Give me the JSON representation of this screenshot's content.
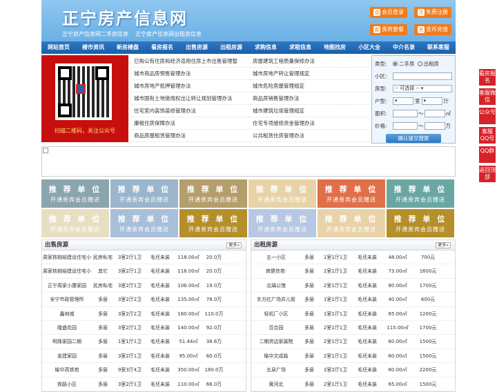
{
  "header": {
    "logo": "正宁房产信息网",
    "sub1": "正宁房产信息网二手房信息",
    "sub2": "正宁房产信息网出租房信息",
    "btns": [
      {
        "icon": "会",
        "label": "会员登录"
      },
      {
        "icon": "注",
        "label": "免费注册"
      },
      {
        "icon": "套",
        "label": "贵宾套餐"
      },
      {
        "icon": "充",
        "label": "金币充值"
      }
    ]
  },
  "nav": [
    "网站首页",
    "楼市资讯",
    "新房楼盘",
    "看房报名",
    "出售房源",
    "出租房源",
    "求购信息",
    "求租信息",
    "地图找房",
    "小区大全",
    "中介名录",
    "联系客服"
  ],
  "qr": {
    "caption": "扫描二维码，关注公众号"
  },
  "links": [
    "已购公有住房和经济适用住房上市出售管理暂",
    "房屋建筑工程质量保修办法",
    "城市商品房预售管理办法",
    "城市房地产转让管理规定",
    "城市房地产抵押管理办法",
    "城市危险房屋管理规定",
    "城市国有土地使用权出让转让规划管理办法",
    "商品房销售管理办法",
    "住宅室内装饰装修管理办法",
    "城市建筑垃圾管理规定",
    "廉租住房保障办法",
    "住宅专项维修资金管理办法",
    "商品房屋租赁管理办法",
    "公共租赁住房管理办法"
  ],
  "search": {
    "type_label": "类型:",
    "opt1": "二手房",
    "opt2": "出租房",
    "xiaoqu_label": "小区:",
    "fangxing_label": "房型:",
    "fangxing_value": "-- 可选择 --",
    "huxing_label": "户型:",
    "shi": "室",
    "ting": "厅",
    "area_label": "面积:",
    "area_unit": "㎡",
    "price_label": "价格:",
    "price_unit": "万",
    "submit": "确认提交搜索"
  },
  "ads": {
    "t1": "推 荐 单 位",
    "t2": "开通贵宾会员赠送",
    "colors": [
      "#8aa5ad",
      "#9bb5cc",
      "#b49e6b",
      "#e8d3a9",
      "#e0704a",
      "#6aa7a3",
      "#e8dfc3",
      "#a8bfd9",
      "#b48f2a",
      "#b6c8e2",
      "#e8d3a9",
      "#b48f2a"
    ]
  },
  "sale": {
    "title": "出售房源",
    "more": "更多»",
    "rows": [
      [
        "周家核桃峪建设住宅小",
        "民房私宅",
        "3室2厅1卫",
        "毛坯未装",
        "118.00㎡",
        "20.0万"
      ],
      [
        "周家核桃峪建设住宅小",
        "其它",
        "3室2厅1卫",
        "毛坯未装",
        "118.00㎡",
        "20.0万"
      ],
      [
        "正宁周家小康家园",
        "民房私宅",
        "3室2厅1卫",
        "毛坯未装",
        "106.00㎡",
        "19.0万"
      ],
      [
        "安宁市政管理所",
        "多层",
        "3室2厅2卫",
        "毛坯未装",
        "135.00㎡",
        "78.0万"
      ],
      [
        "鑫地城",
        "多层",
        "3室2厅2卫",
        "毛坯未装",
        "160.00㎡",
        "110.0万"
      ],
      [
        "隆盛花园",
        "多层",
        "3室2厅1卫",
        "毛坯未装",
        "140.00㎡",
        "92.0万"
      ],
      [
        "明珠家园二期",
        "多层",
        "1室1厅1卫",
        "毛坯未装",
        "51.44㎡",
        "38.6万"
      ],
      [
        "金建家园",
        "多层",
        "3室2厅1卫",
        "毛坯未装",
        "95.00㎡",
        "60.0万"
      ],
      [
        "榆中高铁苑",
        "多层",
        "9室3厅4卫",
        "毛坯未装",
        "350.00㎡",
        "180.0万"
      ],
      [
        "铁路小区",
        "多层",
        "3室2厅1卫",
        "毛坯未装",
        "110.00㎡",
        "66.0万"
      ]
    ]
  },
  "rent": {
    "title": "出租房源",
    "more": "更多»",
    "rows": [
      [
        "五一小区",
        "多层",
        "1室1厅1卫",
        "毛坯未装",
        "48.00㎡",
        "700元"
      ],
      [
        "商健信苑·",
        "多层",
        "2室1厅1卫",
        "毛坯未装",
        "73.00㎡",
        "1600元"
      ],
      [
        "北璃公馆",
        "多层",
        "2室1厅1卫",
        "毛坯未装",
        "80.00㎡",
        "1700元"
      ],
      [
        "东方红广场井儿街",
        "多层",
        "1室1厅1卫",
        "毛坯未装",
        "40.00㎡",
        "600元"
      ],
      [
        "轻机厂小区",
        "多层",
        "1室1厅1卫",
        "毛坯未装",
        "65.00㎡",
        "1200元"
      ],
      [
        "百合园",
        "多层",
        "2室1厅1卫",
        "毛坯未装",
        "115.00㎡",
        "1700元"
      ],
      [
        "二期资边家属院",
        "多层",
        "2室1厅1卫",
        "毛坯未装",
        "60.00㎡",
        "1500元"
      ],
      [
        "榆中文成路",
        "多层",
        "2室1厅1卫",
        "毛坯未装",
        "60.00㎡",
        "1500元"
      ],
      [
        "五泉广场",
        "多层",
        "2室2厅1卫",
        "毛坯未装",
        "60.00㎡",
        "2200元"
      ],
      [
        "黄河北",
        "多层",
        "2室1厅1卫",
        "毛坯未装",
        "65.00㎡",
        "1500元"
      ]
    ]
  },
  "sidebar": [
    "看房报名",
    "客服微信",
    "公众号",
    "客服QQ号",
    "QQ群",
    "返回顶部"
  ]
}
